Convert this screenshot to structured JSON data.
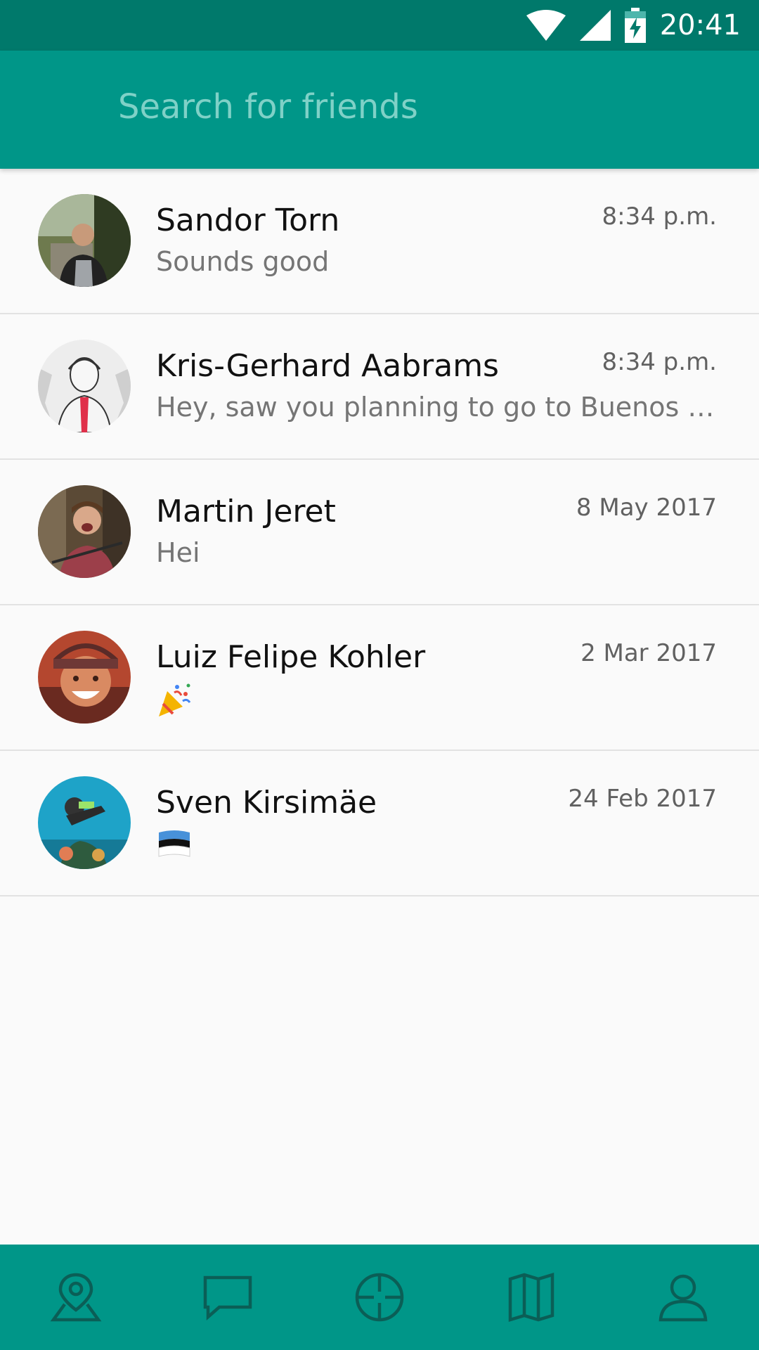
{
  "status_bar": {
    "time": "20:41",
    "icons": [
      "wifi-icon",
      "cellular-signal-icon",
      "battery-charging-icon"
    ]
  },
  "search": {
    "placeholder": "Search for friends",
    "value": ""
  },
  "conversations": [
    {
      "name": "Sandor Torn",
      "message": "Sounds good",
      "date": "8:34 p.m.",
      "avatar": "avatar-photo"
    },
    {
      "name": "Kris-Gerhard Aabrams",
      "message": "Hey, saw you planning to go to Buenos Aires",
      "date": "8:34 p.m.",
      "avatar": "avatar-sketch"
    },
    {
      "name": "Martin Jeret",
      "message": "Hei",
      "date": "8 May 2017",
      "avatar": "avatar-photo"
    },
    {
      "name": "Luiz Felipe Kohler",
      "message": "",
      "message_icon": "party-popper-icon",
      "date": "2 Mar 2017",
      "avatar": "avatar-photo"
    },
    {
      "name": "Sven Kirsimäe",
      "message": "",
      "message_icon": "estonia-flag-icon",
      "date": "24 Feb 2017",
      "avatar": "avatar-photo"
    }
  ],
  "bottom_nav": [
    "map-pin-icon",
    "chat-icon",
    "target-icon",
    "map-icon",
    "profile-icon"
  ],
  "colors": {
    "status_bar": "#00796B",
    "app_bar": "#009688",
    "nav_icon": "#0B5E56",
    "placeholder": "#7FD1C7"
  }
}
